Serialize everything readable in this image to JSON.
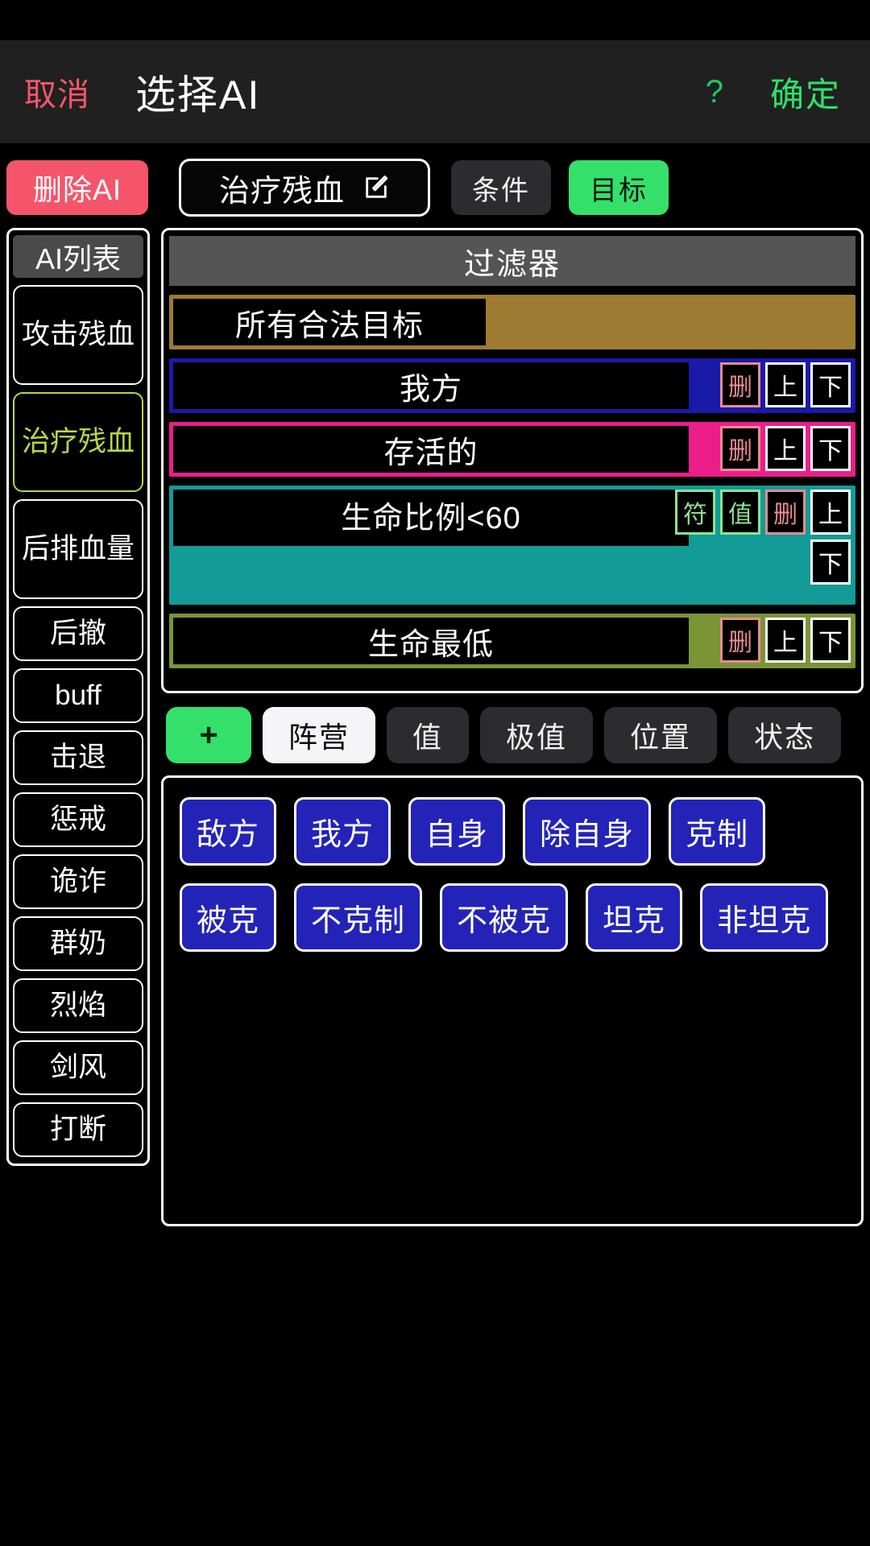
{
  "header": {
    "cancel_label": "取消",
    "title": "选择AI",
    "help_label": "?",
    "confirm_label": "确定",
    "accent_red": "#f4556b",
    "accent_green": "#2fe06a"
  },
  "toolbar": {
    "delete_ai_label": "删除AI",
    "ai_name_value": "治疗残血",
    "edit_icon": "edit-pencil-icon",
    "tabs": [
      {
        "label": "条件",
        "active": false
      },
      {
        "label": "目标",
        "active": true
      }
    ]
  },
  "sidebar": {
    "header_label": "AI列表",
    "items": [
      {
        "label": "攻击残血",
        "selected": false
      },
      {
        "label": "治疗残血",
        "selected": true
      },
      {
        "label": "后排血量",
        "selected": false
      },
      {
        "label": "后撤",
        "selected": false
      },
      {
        "label": "buff",
        "selected": false
      },
      {
        "label": "击退",
        "selected": false
      },
      {
        "label": "惩戒",
        "selected": false
      },
      {
        "label": "诡诈",
        "selected": false
      },
      {
        "label": "群奶",
        "selected": false
      },
      {
        "label": "烈焰",
        "selected": false
      },
      {
        "label": "剑风",
        "selected": false
      },
      {
        "label": "打断",
        "selected": false
      }
    ]
  },
  "filter_panel": {
    "header_label": "过滤器",
    "rows": [
      {
        "label": "所有合法目标",
        "color": "#9d7b32",
        "actions": []
      },
      {
        "label": "我方",
        "color": "#1a1aa8",
        "actions": [
          {
            "label": "删",
            "kind": "delete"
          },
          {
            "label": "上",
            "kind": "up"
          },
          {
            "label": "下",
            "kind": "down"
          }
        ]
      },
      {
        "label": "存活的",
        "color": "#ec1e8a",
        "actions": [
          {
            "label": "删",
            "kind": "delete"
          },
          {
            "label": "上",
            "kind": "up"
          },
          {
            "label": "下",
            "kind": "down"
          }
        ]
      },
      {
        "label": "生命比例<60",
        "color": "#139b97",
        "actions": [
          {
            "label": "符",
            "kind": "symbol"
          },
          {
            "label": "值",
            "kind": "value"
          },
          {
            "label": "删",
            "kind": "delete"
          },
          {
            "label": "上",
            "kind": "up"
          },
          {
            "label": "下",
            "kind": "down"
          }
        ]
      },
      {
        "label": "生命最低",
        "color": "#7a9436",
        "actions": [
          {
            "label": "删",
            "kind": "delete"
          },
          {
            "label": "上",
            "kind": "up"
          },
          {
            "label": "下",
            "kind": "down"
          }
        ]
      }
    ]
  },
  "category_tabs": {
    "add_label": "+",
    "items": [
      {
        "label": "阵营",
        "active": true
      },
      {
        "label": "值",
        "active": false
      },
      {
        "label": "极值",
        "active": false
      },
      {
        "label": "位置",
        "active": false
      },
      {
        "label": "状态",
        "active": false
      }
    ]
  },
  "chips": [
    {
      "label": "敌方"
    },
    {
      "label": "我方"
    },
    {
      "label": "自身"
    },
    {
      "label": "除自身"
    },
    {
      "label": "克制"
    },
    {
      "label": "被克"
    },
    {
      "label": "不克制"
    },
    {
      "label": "不被克"
    },
    {
      "label": "坦克"
    },
    {
      "label": "非坦克"
    }
  ]
}
